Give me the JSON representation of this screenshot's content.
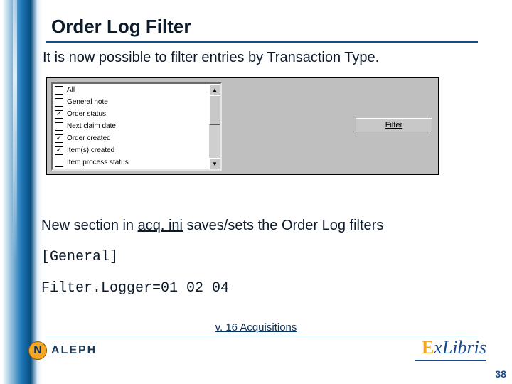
{
  "title": "Order Log Filter",
  "intro": "It is now possible to filter entries by Transaction Type.",
  "listbox": {
    "items": [
      {
        "label": "All",
        "checked": false
      },
      {
        "label": "General note",
        "checked": false
      },
      {
        "label": "Order status",
        "checked": true
      },
      {
        "label": "Next claim date",
        "checked": false
      },
      {
        "label": "Order created",
        "checked": true
      },
      {
        "label": "Item(s) created",
        "checked": true
      },
      {
        "label": "Item process status",
        "checked": false
      }
    ]
  },
  "filter_button": "Filter",
  "note_pre": "New section in ",
  "note_file": "acq. ini",
  "note_post": " saves/sets the Order Log filters",
  "code_section": "[General]",
  "code_line": "Filter.Logger=01 02 04",
  "footer": "v. 16 Acquisitions",
  "page_number": "38",
  "logo_aleph_glyph": "N",
  "logo_aleph": "ALEPH",
  "logo_exlibris_e": "E",
  "logo_exlibris_rest": "xLibris"
}
